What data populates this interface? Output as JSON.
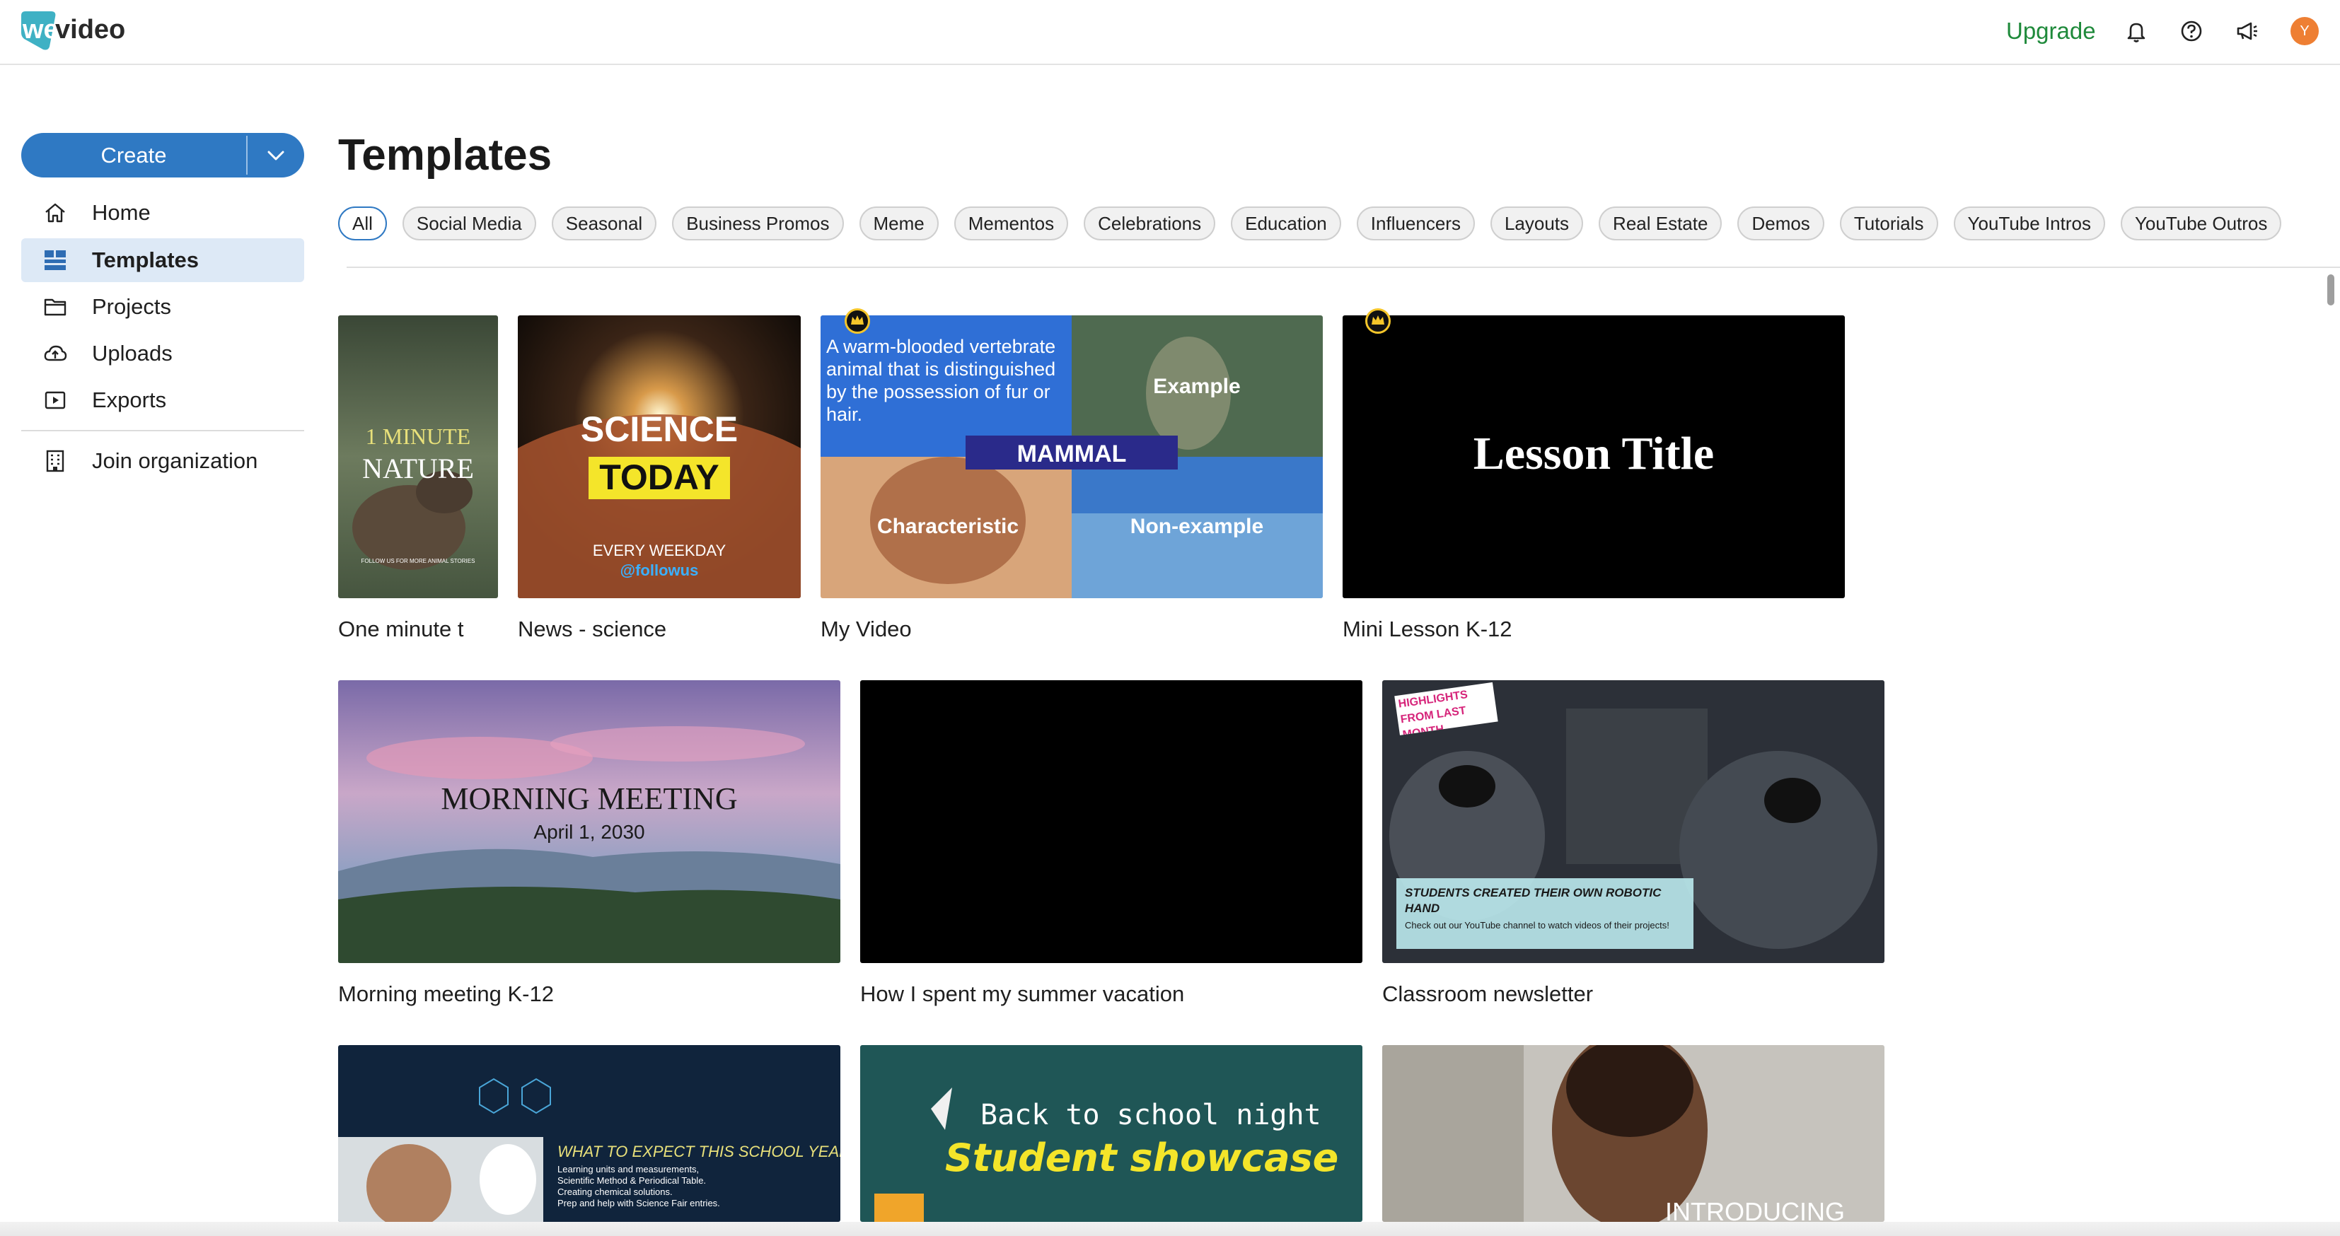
{
  "app": {
    "logo_text": "wevideo",
    "upgrade_label": "Upgrade",
    "avatar_initial": "Y"
  },
  "sidebar": {
    "create_label": "Create",
    "items": [
      {
        "label": "Home",
        "icon": "home-icon"
      },
      {
        "label": "Templates",
        "icon": "templates-grid-icon",
        "active": true
      },
      {
        "label": "Projects",
        "icon": "folder-icon"
      },
      {
        "label": "Uploads",
        "icon": "cloud-upload-icon"
      },
      {
        "label": "Exports",
        "icon": "export-play-icon"
      }
    ],
    "org_label": "Join organization"
  },
  "main": {
    "title": "Templates",
    "categories": [
      "All",
      "Social Media",
      "Seasonal",
      "Business Promos",
      "Meme",
      "Mementos",
      "Celebrations",
      "Education",
      "Influencers",
      "Layouts",
      "Real Estate",
      "Demos",
      "Tutorials",
      "YouTube Intros",
      "YouTube Outros"
    ],
    "selected_category": "All",
    "templates": [
      {
        "name": "One minute t",
        "thumb": {
          "line1": "1 MINUTE",
          "line2": "NATURE",
          "line3": "FOLLOW US FOR MORE ANIMAL STORIES"
        }
      },
      {
        "name": "News - science",
        "thumb": {
          "line1": "SCIENCE",
          "line2": "TODAY",
          "line3": "EVERY WEEKDAY",
          "line4": "@followus"
        }
      },
      {
        "name": "My Video",
        "premium": true,
        "thumb": {
          "definition": "A warm-blooded vertebrate animal that is distinguished by the possession of fur or hair.",
          "word": "MAMMAL",
          "example": "Example",
          "characteristic": "Characteristic",
          "non_example": "Non-example"
        }
      },
      {
        "name": "Mini Lesson K-12",
        "premium": true,
        "thumb": {
          "title": "Lesson Title"
        }
      },
      {
        "name": "Morning meeting K-12",
        "thumb": {
          "line1": "MORNING MEETING",
          "line2": "April 1, 2030"
        }
      },
      {
        "name": "How I spent my summer vacation",
        "thumb": {}
      },
      {
        "name": "Classroom newsletter",
        "thumb": {
          "tag": "HIGHLIGHTS FROM LAST MONTH",
          "headline": "STUDENTS CREATED THEIR OWN ROBOTIC HAND",
          "body": "Check out our YouTube channel to watch videos of their projects!"
        }
      },
      {
        "name": "",
        "thumb": {
          "heading": "WHAT TO EXPECT THIS SCHOOL YEAR",
          "b1": "Learning units and measurements,",
          "b2": "Scientific Method & Periodical Table.",
          "b3": "Creating chemical solutions.",
          "b4": "Prep and help with Science Fair entries."
        }
      },
      {
        "name": "",
        "thumb": {
          "line1": "Back to school night",
          "line2": "Student showcase"
        }
      },
      {
        "name": "",
        "thumb": {
          "line1": "INTRODUCING"
        }
      }
    ]
  },
  "colors": {
    "accent": "#2f79c3",
    "upgrade": "#1f8a3b",
    "avatar": "#ee7f33",
    "premium_crown": "#f5c62a"
  }
}
